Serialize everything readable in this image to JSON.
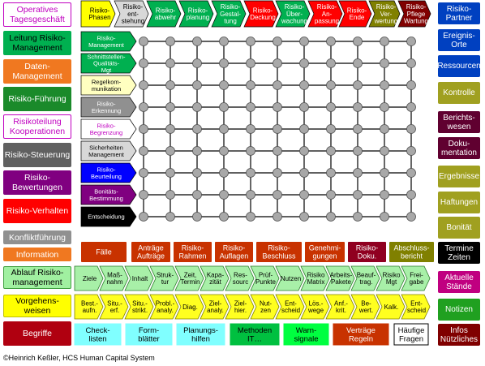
{
  "left_column": [
    {
      "label": "Operatives Tagesgeschäft",
      "bg": "#ffffff",
      "fg": "#c000c0",
      "border": "#c000c0"
    },
    {
      "label": "Leitung Risiko-Management",
      "bg": "#00b050",
      "fg": "#000000",
      "border": "#00b050"
    },
    {
      "label": "Daten-Management",
      "bg": "#f07820",
      "fg": "#ffffff",
      "border": "#f07820"
    },
    {
      "label": "Risiko-Führung",
      "bg": "#1a8a2a",
      "fg": "#ffffff",
      "border": "#1a8a2a"
    },
    {
      "label": "Risikoteilung Kooperationen",
      "bg": "#ffffff",
      "fg": "#c000c0",
      "border": "#c000c0"
    },
    {
      "label": "Risiko-Steuerung",
      "bg": "#606060",
      "fg": "#ffffff",
      "border": "#606060"
    },
    {
      "label": "Risiko-Bewertungen",
      "bg": "#800080",
      "fg": "#ffffff",
      "border": "#800080"
    },
    {
      "label": "Risiko-Verhalten",
      "bg": "#ff0000",
      "fg": "#ffffff",
      "border": "#ff0000"
    },
    {
      "label": "Konfliktführung",
      "bg": "#909090",
      "fg": "#ffffff",
      "border": "#909090"
    },
    {
      "label": "Information",
      "bg": "#f07820",
      "fg": "#ffffff",
      "border": "#f07820"
    },
    {
      "label": "Ablauf Risiko-management",
      "bg": "#a0f0a0",
      "fg": "#000000",
      "border": "#40a040"
    },
    {
      "label": "Vorgehens-weisen",
      "bg": "#ffff00",
      "fg": "#000000",
      "border": "#c0c000"
    },
    {
      "label": "Begriffe",
      "bg": "#b00010",
      "fg": "#ffffff",
      "border": "#b00010"
    }
  ],
  "right_column": [
    {
      "label": "Risiko-Partner",
      "bg": "#0040c0",
      "fg": "#ffffff"
    },
    {
      "label": "Ereignis-Orte",
      "bg": "#0040c0",
      "fg": "#ffffff"
    },
    {
      "label": "Ressourcen",
      "bg": "#0040c0",
      "fg": "#ffffff"
    },
    {
      "label": "Kontrolle",
      "bg": "#a0a020",
      "fg": "#ffffff"
    },
    {
      "label": "Berichts-wesen",
      "bg": "#600030",
      "fg": "#ffffff"
    },
    {
      "label": "Doku-mentation",
      "bg": "#600030",
      "fg": "#ffffff"
    },
    {
      "label": "Ergebnisse",
      "bg": "#a0a020",
      "fg": "#ffffff"
    },
    {
      "label": "Haftungen",
      "bg": "#a0a020",
      "fg": "#ffffff"
    },
    {
      "label": "Bonität",
      "bg": "#a0a020",
      "fg": "#ffffff"
    },
    {
      "label": "Termine Zeiten",
      "bg": "#000000",
      "fg": "#ffffff"
    },
    {
      "label": "Aktuelle Stände",
      "bg": "#c00080",
      "fg": "#ffffff"
    },
    {
      "label": "Notizen",
      "bg": "#20a020",
      "fg": "#ffffff"
    },
    {
      "label": "Infos Nützliches",
      "bg": "#800000",
      "fg": "#ffffff"
    }
  ],
  "phases": [
    {
      "label": "Risiko-Phasen",
      "bg": "#ffff00",
      "fg": "#000000"
    },
    {
      "label": "Risiko-ent-stehung",
      "bg": "#d8d8d8",
      "fg": "#000000"
    },
    {
      "label": "Risiko-abwehr",
      "bg": "#00b050",
      "fg": "#ffffff"
    },
    {
      "label": "Risiko-planung",
      "bg": "#00b050",
      "fg": "#ffffff"
    },
    {
      "label": "Risiko-Gestal-tung",
      "bg": "#00b050",
      "fg": "#ffffff"
    },
    {
      "label": "Risiko-Deckung",
      "bg": "#ff0000",
      "fg": "#ffffff"
    },
    {
      "label": "Risiko-Über-wachung",
      "bg": "#00b050",
      "fg": "#ffffff"
    },
    {
      "label": "Risiko-An-passung",
      "bg": "#ff0000",
      "fg": "#ffffff"
    },
    {
      "label": "Risiko-Ende",
      "bg": "#ff0000",
      "fg": "#ffffff"
    },
    {
      "label": "Risiko-Ver-wertung",
      "bg": "#808000",
      "fg": "#ffffff"
    },
    {
      "label": "Risiko-Pflege Wartung",
      "bg": "#800000",
      "fg": "#ffffff"
    }
  ],
  "rows": [
    {
      "label": "Risiko-Management",
      "bg": "#00b050",
      "fg": "#ffffff"
    },
    {
      "label": "Schnittstellen-Qualitäts-Mgt",
      "bg": "#00b050",
      "fg": "#ffffff"
    },
    {
      "label": "Regelkom-munikation",
      "bg": "#ffffc0",
      "fg": "#000000"
    },
    {
      "label": "Risiko-Erkennung",
      "bg": "#909090",
      "fg": "#ffffff"
    },
    {
      "label": "Risiko-Begrenzung",
      "bg": "#ffffff",
      "fg": "#c000c0"
    },
    {
      "label": "Sicherheiten Management",
      "bg": "#d8d8d8",
      "fg": "#000000"
    },
    {
      "label": "Risiko-Beurteilung",
      "bg": "#0000ff",
      "fg": "#ffffff"
    },
    {
      "label": "Bonitäts-Bestimmung",
      "bg": "#800080",
      "fg": "#ffffff"
    },
    {
      "label": "Entscheidung",
      "bg": "#000000",
      "fg": "#ffffff"
    }
  ],
  "red_row": [
    {
      "label": "Fälle",
      "bg": "#c83200"
    },
    {
      "label": "Anträge Aufträge",
      "bg": "#c83200"
    },
    {
      "label": "Risiko-Rahmen",
      "bg": "#c83200"
    },
    {
      "label": "Risiko-Auflagen",
      "bg": "#c83200"
    },
    {
      "label": "Risiko-Beschluss",
      "bg": "#c83200"
    },
    {
      "label": "Genehmi-gungen",
      "bg": "#c83200"
    },
    {
      "label": "Risiko-Doku.",
      "bg": "#900020"
    },
    {
      "label": "Abschluss-bericht",
      "bg": "#808000"
    }
  ],
  "ablauf_row": [
    "Ziele",
    "Maß-nahm",
    "Inhalt",
    "Struk-tur",
    "Zeit, Termin",
    "Kapa-zität",
    "Res-sourc",
    "Prüf-Punkte",
    "Nutzen",
    "Risiko Matrix",
    "Arbeits-Pakete",
    "Beauf-trag.",
    "Risiko Mgt",
    "Frei-gabe"
  ],
  "vorgehen_row": [
    "Best.-aufn.",
    "Situ.-erf.",
    "Situ.-strikt.",
    "Probl.-analy.",
    "Diag.",
    "Ziel-analy.",
    "Ziel-hier.",
    "Nut-zen",
    "Ent-scheid",
    "Lös.-wege",
    "Anf.-krit.",
    "Be-wert.",
    "Kalk.",
    "Ent-scheid"
  ],
  "bottom_row": [
    {
      "label": "Check-listen",
      "bg": "#80ffff",
      "fg": "#000000",
      "border": "#80ffff"
    },
    {
      "label": "Form-blätter",
      "bg": "#80ffff",
      "fg": "#000000",
      "border": "#80ffff"
    },
    {
      "label": "Planungs-hilfen",
      "bg": "#80ffff",
      "fg": "#000000",
      "border": "#80ffff"
    },
    {
      "label": "Methoden IT…",
      "bg": "#00c040",
      "fg": "#000000",
      "border": "#00c040"
    },
    {
      "label": "Warn-signale",
      "bg": "#00ff40",
      "fg": "#000000",
      "border": "#00ff40"
    },
    {
      "label": "Verträge Regeln",
      "bg": "#c83200",
      "fg": "#ffffff",
      "border": "#c83200"
    },
    {
      "label": "Häufige Fragen",
      "bg": "#ffffff",
      "fg": "#000000",
      "border": "#000000"
    }
  ],
  "footer": "©Heinrich Keßler, HCS Human Capital System"
}
